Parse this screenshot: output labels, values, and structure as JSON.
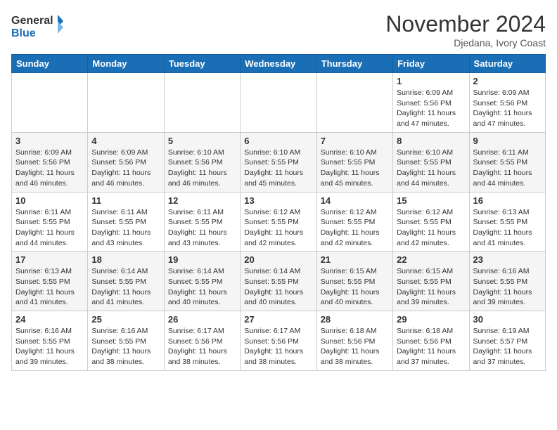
{
  "header": {
    "logo_line1": "General",
    "logo_line2": "Blue",
    "month": "November 2024",
    "location": "Djedana, Ivory Coast"
  },
  "days_of_week": [
    "Sunday",
    "Monday",
    "Tuesday",
    "Wednesday",
    "Thursday",
    "Friday",
    "Saturday"
  ],
  "weeks": [
    [
      {
        "day": "",
        "info": ""
      },
      {
        "day": "",
        "info": ""
      },
      {
        "day": "",
        "info": ""
      },
      {
        "day": "",
        "info": ""
      },
      {
        "day": "",
        "info": ""
      },
      {
        "day": "1",
        "info": "Sunrise: 6:09 AM\nSunset: 5:56 PM\nDaylight: 11 hours and 47 minutes."
      },
      {
        "day": "2",
        "info": "Sunrise: 6:09 AM\nSunset: 5:56 PM\nDaylight: 11 hours and 47 minutes."
      }
    ],
    [
      {
        "day": "3",
        "info": "Sunrise: 6:09 AM\nSunset: 5:56 PM\nDaylight: 11 hours and 46 minutes."
      },
      {
        "day": "4",
        "info": "Sunrise: 6:09 AM\nSunset: 5:56 PM\nDaylight: 11 hours and 46 minutes."
      },
      {
        "day": "5",
        "info": "Sunrise: 6:10 AM\nSunset: 5:56 PM\nDaylight: 11 hours and 46 minutes."
      },
      {
        "day": "6",
        "info": "Sunrise: 6:10 AM\nSunset: 5:55 PM\nDaylight: 11 hours and 45 minutes."
      },
      {
        "day": "7",
        "info": "Sunrise: 6:10 AM\nSunset: 5:55 PM\nDaylight: 11 hours and 45 minutes."
      },
      {
        "day": "8",
        "info": "Sunrise: 6:10 AM\nSunset: 5:55 PM\nDaylight: 11 hours and 44 minutes."
      },
      {
        "day": "9",
        "info": "Sunrise: 6:11 AM\nSunset: 5:55 PM\nDaylight: 11 hours and 44 minutes."
      }
    ],
    [
      {
        "day": "10",
        "info": "Sunrise: 6:11 AM\nSunset: 5:55 PM\nDaylight: 11 hours and 44 minutes."
      },
      {
        "day": "11",
        "info": "Sunrise: 6:11 AM\nSunset: 5:55 PM\nDaylight: 11 hours and 43 minutes."
      },
      {
        "day": "12",
        "info": "Sunrise: 6:11 AM\nSunset: 5:55 PM\nDaylight: 11 hours and 43 minutes."
      },
      {
        "day": "13",
        "info": "Sunrise: 6:12 AM\nSunset: 5:55 PM\nDaylight: 11 hours and 42 minutes."
      },
      {
        "day": "14",
        "info": "Sunrise: 6:12 AM\nSunset: 5:55 PM\nDaylight: 11 hours and 42 minutes."
      },
      {
        "day": "15",
        "info": "Sunrise: 6:12 AM\nSunset: 5:55 PM\nDaylight: 11 hours and 42 minutes."
      },
      {
        "day": "16",
        "info": "Sunrise: 6:13 AM\nSunset: 5:55 PM\nDaylight: 11 hours and 41 minutes."
      }
    ],
    [
      {
        "day": "17",
        "info": "Sunrise: 6:13 AM\nSunset: 5:55 PM\nDaylight: 11 hours and 41 minutes."
      },
      {
        "day": "18",
        "info": "Sunrise: 6:14 AM\nSunset: 5:55 PM\nDaylight: 11 hours and 41 minutes."
      },
      {
        "day": "19",
        "info": "Sunrise: 6:14 AM\nSunset: 5:55 PM\nDaylight: 11 hours and 40 minutes."
      },
      {
        "day": "20",
        "info": "Sunrise: 6:14 AM\nSunset: 5:55 PM\nDaylight: 11 hours and 40 minutes."
      },
      {
        "day": "21",
        "info": "Sunrise: 6:15 AM\nSunset: 5:55 PM\nDaylight: 11 hours and 40 minutes."
      },
      {
        "day": "22",
        "info": "Sunrise: 6:15 AM\nSunset: 5:55 PM\nDaylight: 11 hours and 39 minutes."
      },
      {
        "day": "23",
        "info": "Sunrise: 6:16 AM\nSunset: 5:55 PM\nDaylight: 11 hours and 39 minutes."
      }
    ],
    [
      {
        "day": "24",
        "info": "Sunrise: 6:16 AM\nSunset: 5:55 PM\nDaylight: 11 hours and 39 minutes."
      },
      {
        "day": "25",
        "info": "Sunrise: 6:16 AM\nSunset: 5:55 PM\nDaylight: 11 hours and 38 minutes."
      },
      {
        "day": "26",
        "info": "Sunrise: 6:17 AM\nSunset: 5:56 PM\nDaylight: 11 hours and 38 minutes."
      },
      {
        "day": "27",
        "info": "Sunrise: 6:17 AM\nSunset: 5:56 PM\nDaylight: 11 hours and 38 minutes."
      },
      {
        "day": "28",
        "info": "Sunrise: 6:18 AM\nSunset: 5:56 PM\nDaylight: 11 hours and 38 minutes."
      },
      {
        "day": "29",
        "info": "Sunrise: 6:18 AM\nSunset: 5:56 PM\nDaylight: 11 hours and 37 minutes."
      },
      {
        "day": "30",
        "info": "Sunrise: 6:19 AM\nSunset: 5:57 PM\nDaylight: 11 hours and 37 minutes."
      }
    ]
  ]
}
